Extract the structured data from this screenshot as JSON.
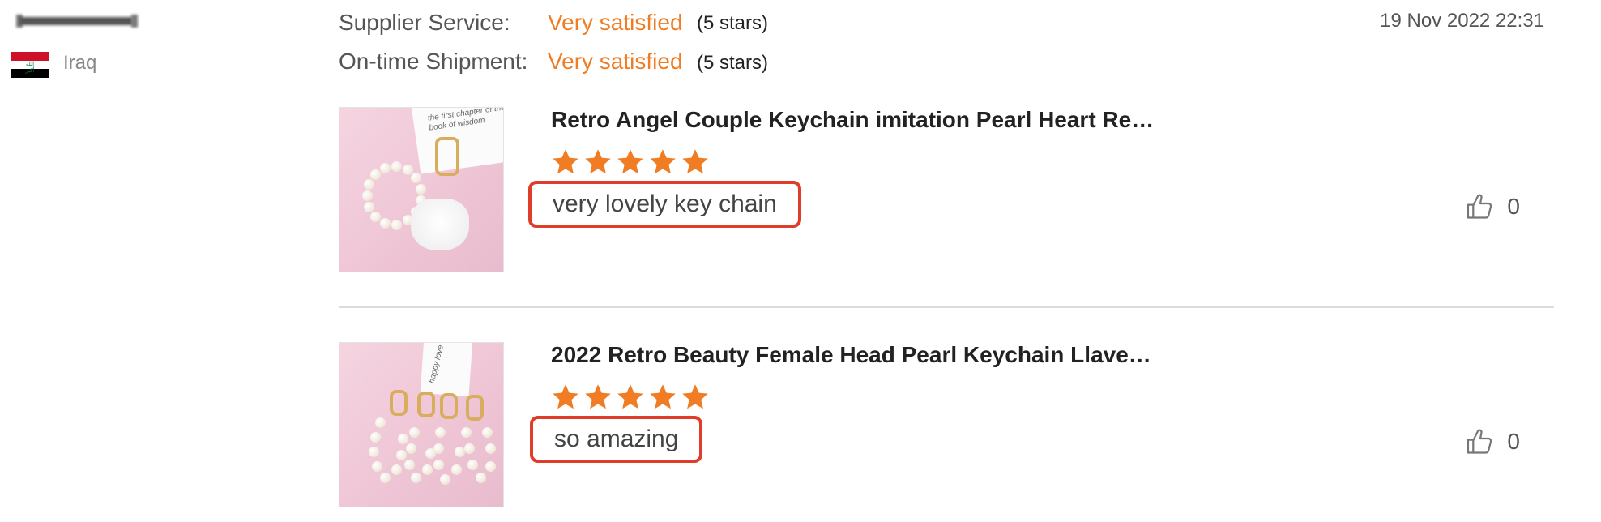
{
  "reviewer": {
    "country": "Iraq",
    "flag_colors": [
      "#ce1126",
      "#ffffff",
      "#000000"
    ]
  },
  "date": "19 Nov 2022 22:31",
  "ratings": [
    {
      "label": "Supplier Service:",
      "value": "Very satisfied",
      "stars_text": "(5 stars)"
    },
    {
      "label": "On-time Shipment:",
      "value": "Very satisfied",
      "stars_text": "(5 stars)"
    }
  ],
  "reviews": [
    {
      "product_title": "Retro Angel Couple Keychain imitation Pearl Heart Re…",
      "rating": 5,
      "comment": "very lovely key chain",
      "likes": "0",
      "thumb_card_text": "the first chapter of the book of wisdom"
    },
    {
      "product_title": "2022 Retro Beauty Female Head Pearl Keychain Llave…",
      "rating": 5,
      "comment": "so amazing",
      "likes": "0",
      "thumb_card_text": "happy love"
    }
  ],
  "colors": {
    "accent": "#f07c23",
    "star": "#f07c23",
    "highlight_box": "#e03c2a"
  },
  "icons": {
    "like": "thumbs-up-icon",
    "star": "star-icon"
  }
}
